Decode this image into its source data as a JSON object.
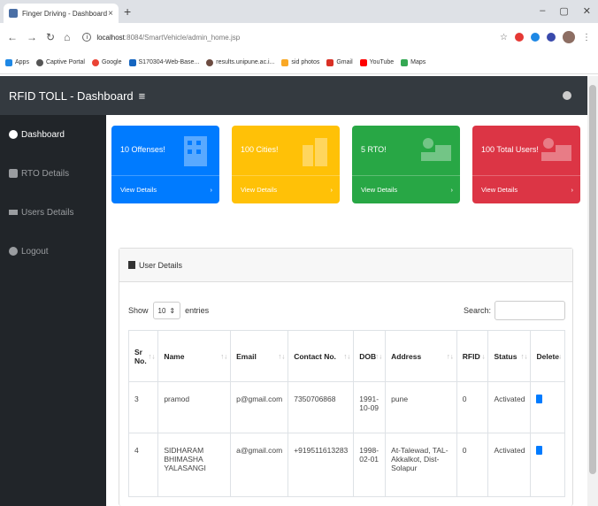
{
  "browser": {
    "tab_title": "Finger Driving - Dashboard",
    "tab_close": "×",
    "new_tab": "+",
    "url_host": "localhost",
    "url_path": ":8084/SmartVehicle/admin_home.jsp",
    "bookmarks": [
      "Apps",
      "Captive Portal",
      "Google",
      "S170304-Web-Base...",
      "results.unipune.ac.i...",
      "sid photos",
      "Gmail",
      "YouTube",
      "Maps"
    ]
  },
  "navbar": {
    "brand": "RFID TOLL - Dashboard",
    "menu_glyph": "≡"
  },
  "sidebar": {
    "items": [
      {
        "label": "Dashboard",
        "active": true
      },
      {
        "label": "RTO Details",
        "active": false
      },
      {
        "label": "Users Details",
        "active": false
      },
      {
        "label": "Logout",
        "active": false
      }
    ]
  },
  "cards": [
    {
      "title": "10 Offenses!",
      "link": "View Details",
      "color": "#007bff"
    },
    {
      "title": "100 Cities!",
      "link": "View Details",
      "color": "#ffc107"
    },
    {
      "title": "5 RTO!",
      "link": "View Details",
      "color": "#28a745"
    },
    {
      "title": "100 Total Users!",
      "link": "View Details",
      "color": "#dc3545"
    }
  ],
  "panel": {
    "title": "User Details",
    "show_label": "Show",
    "entries_value": "10",
    "entries_label": "entries",
    "search_label": "Search:"
  },
  "table": {
    "headers": [
      "Sr No.",
      "Name",
      "Email",
      "Contact No.",
      "DOB",
      "Address",
      "RFID",
      "Status",
      "Delete"
    ],
    "rows": [
      {
        "sr": "3",
        "name": "pramod",
        "email": "p@gmail.com",
        "contact": "7350706868",
        "dob": "1991-10-09",
        "address": "pune",
        "rfid": "0",
        "status": "Activated"
      },
      {
        "sr": "4",
        "name": "SIDHARAM BHIMASHA YALASANGI",
        "email": "a@gmail.com",
        "contact": "+919511613283",
        "dob": "1998-02-01",
        "address": "At-Talewad, TAL-Akkalkot, Dist-Solapur",
        "rfid": "0",
        "status": "Activated"
      }
    ]
  }
}
